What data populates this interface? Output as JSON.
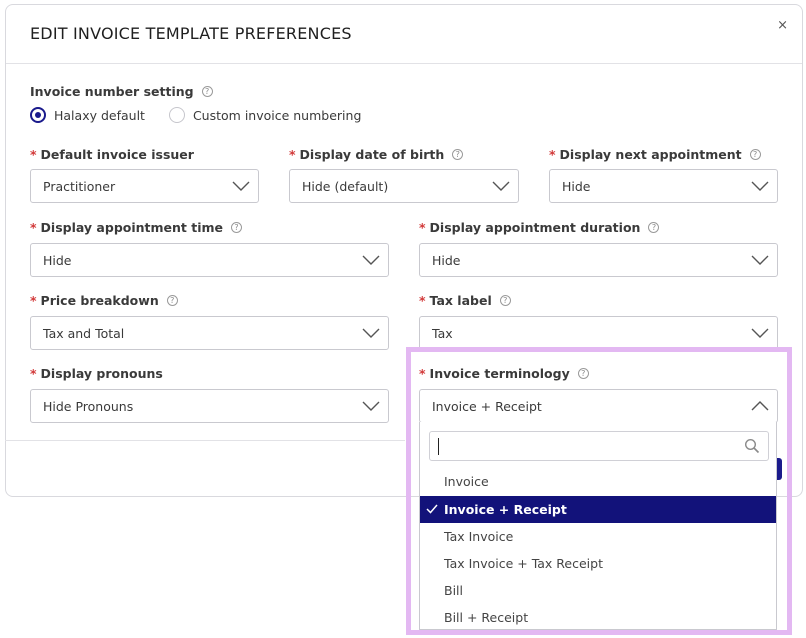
{
  "modal": {
    "title": "EDIT INVOICE TEMPLATE PREFERENCES",
    "close": "×"
  },
  "invoice_number_setting": {
    "label": "Invoice number setting",
    "options": [
      "Halaxy default",
      "Custom invoice numbering"
    ],
    "selected": "Halaxy default"
  },
  "fields": {
    "default_invoice_issuer": {
      "label": "Default invoice issuer",
      "value": "Practitioner"
    },
    "display_date_of_birth": {
      "label": "Display date of birth",
      "value": "Hide (default)"
    },
    "display_next_appointment": {
      "label": "Display next appointment",
      "value": "Hide"
    },
    "display_appointment_time": {
      "label": "Display appointment time",
      "value": "Hide"
    },
    "display_appointment_duration": {
      "label": "Display appointment duration",
      "value": "Hide"
    },
    "price_breakdown": {
      "label": "Price breakdown",
      "value": "Tax and Total"
    },
    "tax_label": {
      "label": "Tax label",
      "value": "Tax"
    },
    "display_pronouns": {
      "label": "Display pronouns",
      "value": "Hide Pronouns"
    },
    "invoice_terminology": {
      "label": "Invoice terminology",
      "value": "Invoice + Receipt"
    }
  },
  "required_mark": "*",
  "help_glyph": "?",
  "invoice_terminology_dropdown": {
    "search_value": "",
    "options": [
      "Invoice",
      "Invoice + Receipt",
      "Tax Invoice",
      "Tax Invoice + Tax Receipt",
      "Bill",
      "Bill + Receipt"
    ],
    "selected": "Invoice + Receipt",
    "selected_bg": "#12127a"
  },
  "colors": {
    "accent": "#1a1a8c",
    "required": "#d23a3a",
    "highlight_border": "#e3b8f2"
  }
}
